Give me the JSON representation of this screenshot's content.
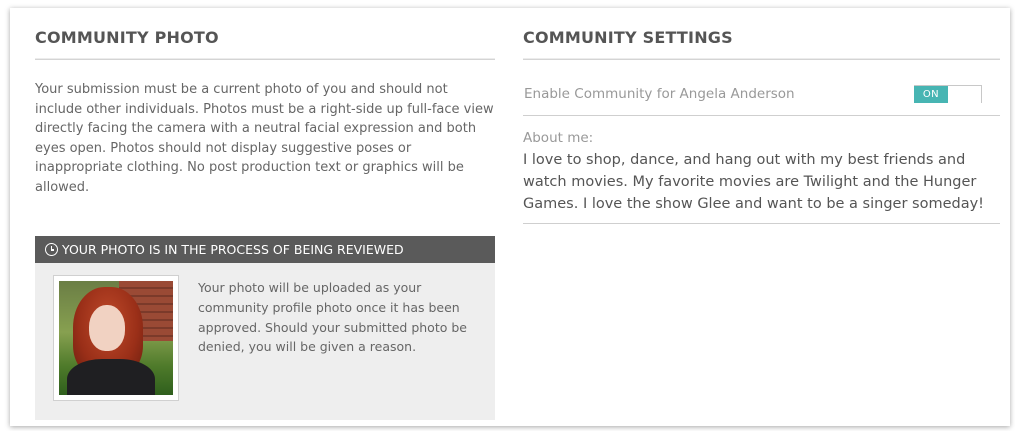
{
  "community_photo": {
    "title": "COMMUNITY PHOTO",
    "intro": "Your submission must be a current photo of you and should not include other individuals. Photos must be a right-side up full-face view directly facing the camera with a neutral facial expression and both eyes open. Photos should not display suggestive poses or inappropriate clothing. No post production text or graphics will be allowed.",
    "review_header_icon": "clock-icon",
    "review_header": "YOUR PHOTO IS IN THE PROCESS OF BEING REVIEWED",
    "review_text": "Your photo will be uploaded as your community profile photo once it has been approved. Should your submitted photo be denied, you will be given a reason."
  },
  "community_settings": {
    "title": "COMMUNITY SETTINGS",
    "enable_label": "Enable Community for Angela Anderson",
    "toggle_state": "ON",
    "about_label": "About me:",
    "about_text": "I love to shop, dance, and hang out with my best friends and watch movies. My favorite movies are Twilight and the Hunger Games. I love the show Glee and want to be a singer someday!"
  },
  "colors": {
    "toggle_on": "#47b5b3",
    "review_header_bg": "#5a5a5a",
    "review_box_bg": "#eeeeee"
  }
}
